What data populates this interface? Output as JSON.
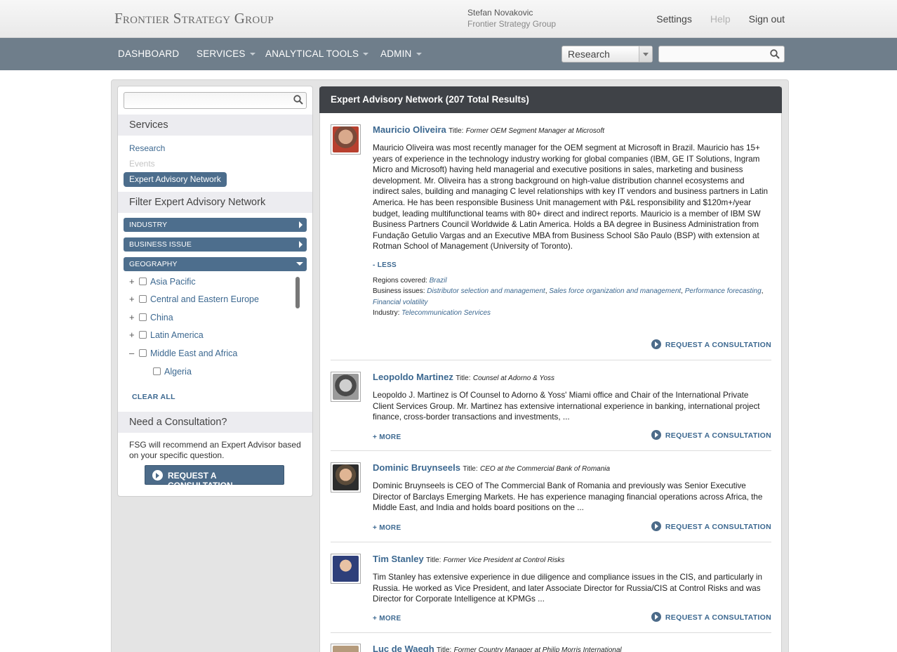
{
  "header": {
    "logo": "Frontier Strategy Group",
    "user_name": "Stefan Novakovic",
    "user_org": "Frontier Strategy Group",
    "links": [
      "Settings",
      "Help",
      "Sign out"
    ]
  },
  "nav": {
    "items": [
      "DASHBOARD",
      "SERVICES",
      "ANALYTICAL TOOLS",
      "ADMIN"
    ],
    "scope_value": "Research",
    "search_placeholder": ""
  },
  "sidebar": {
    "search_placeholder": "",
    "services_heading": "Services",
    "services": [
      "Research",
      "Events",
      "Expert Advisory Network"
    ],
    "filter_heading": "Filter Expert Advisory Network",
    "filters": [
      "INDUSTRY",
      "BUSINESS ISSUE",
      "GEOGRAPHY"
    ],
    "geography": [
      {
        "toggle": "+",
        "label": "Asia Pacific"
      },
      {
        "toggle": "+",
        "label": "Central and Eastern Europe"
      },
      {
        "toggle": "+",
        "label": "China"
      },
      {
        "toggle": "+",
        "label": "Latin America"
      },
      {
        "toggle": "–",
        "label": "Middle East and Africa"
      },
      {
        "toggle": "",
        "label": "Algeria"
      }
    ],
    "clear_all": "CLEAR ALL",
    "consult_heading": "Need a Consultation?",
    "consult_text": "FSG will recommend an Expert Advisor based on your specific question.",
    "consult_button": "REQUEST A CONSULTATION"
  },
  "results": {
    "heading": "Expert Advisory Network (207 Total Results)",
    "title_label": "Title:",
    "request_label": "REQUEST A CONSULTATION",
    "entries": [
      {
        "name": "Mauricio Oliveira",
        "role": "Former OEM Segment Manager at Microsoft",
        "desc": "Mauricio Oliveira was most recently manager for the OEM segment at Microsoft in Brazil. Mauricio has 15+ years of experience in the technology industry working for global companies (IBM, GE IT Solutions, Ingram Micro and Microsoft) having held managerial and executive positions in sales, marketing and business development. Mr. Oliveira has a strong background on high-value distribution channel ecosystems and indirect sales, building and managing C level relationships with key IT vendors and business partners in Latin America. He has been responsible Business Unit management with P&L responsibility and $120m+/year budget, leading multifunctional teams with 80+ direct and indirect reports. Mauricio is a member of IBM SW Business Partners Council Worldwide & Latin America. Holds a BA degree in Business Administration from Fundação Getulio Vargas and an Executive MBA from Business School São Paulo (BSP) with extension at Rotman School of Management (University of Toronto).",
        "toggle": "- LESS",
        "regions_label": "Regions covered:",
        "regions": "Brazil",
        "issues_label": "Business issues:",
        "issues": [
          "Distributor selection and management",
          "Sales force organization and management",
          "Performance forecasting",
          "Financial volatility"
        ],
        "industry_label": "Industry:",
        "industry": "Telecommunication Services"
      },
      {
        "name": "Leopoldo Martinez",
        "role": "Counsel at Adorno & Yoss",
        "desc": "Leopoldo J. Martinez is Of Counsel to Adorno & Yoss' Miami office and Chair of the International Private Client Services Group. Mr. Martinez has extensive international experience in banking, international project finance, cross-border transactions and investments, ...",
        "toggle": "+ MORE"
      },
      {
        "name": "Dominic Bruynseels",
        "role": "CEO at the Commercial Bank of Romania",
        "desc": "Dominic Bruynseels is CEO of The Commercial Bank of Romania and previously was Senior Executive Director of Barclays Emerging Markets. He has experience managing financial operations across Africa, the Middle East, and India and holds board positions on the ...",
        "toggle": "+ MORE"
      },
      {
        "name": "Tim Stanley",
        "role": "Former Vice President at Control Risks",
        "desc": "Tim Stanley has extensive experience in due diligence and compliance issues in the CIS, and particularly in Russia. He worked as Vice President, and later Associate Director for Russia/CIS at Control Risks and was Director for Corporate Intelligence at KPMGs ...",
        "toggle": "+ MORE"
      },
      {
        "name": "Luc de Waegh",
        "role": "Former Country Manager at Philip Morris International"
      }
    ]
  }
}
